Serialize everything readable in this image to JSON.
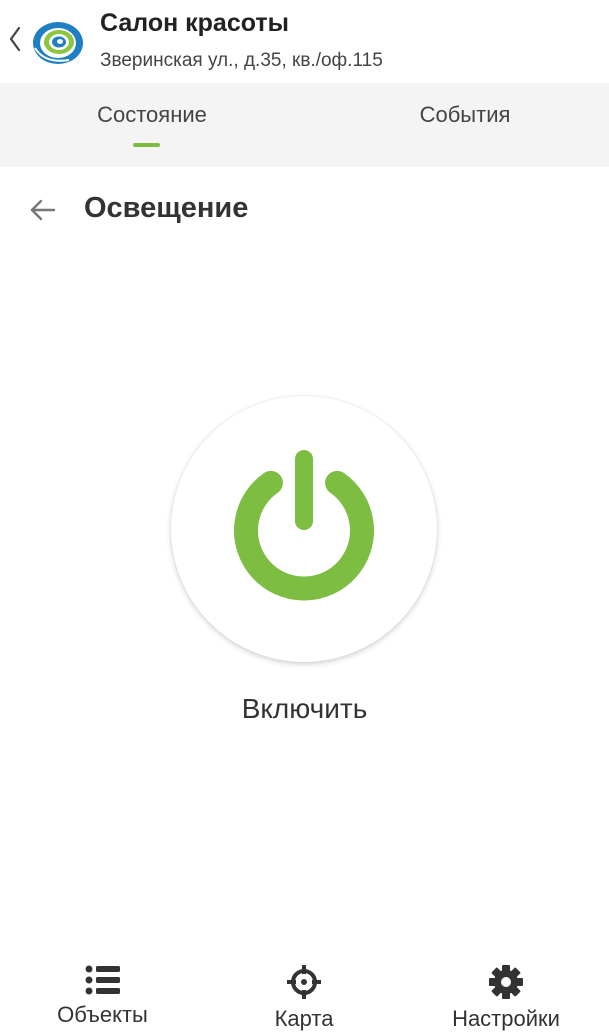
{
  "header": {
    "back_icon": "chevron-left-icon",
    "logo": "company-logo",
    "title": "Салон красоты",
    "subtitle": "Зверинская ул., д.35, кв./оф.115"
  },
  "tabs": [
    {
      "label": "Состояние",
      "active": true
    },
    {
      "label": "События",
      "active": false
    }
  ],
  "section": {
    "back_icon": "arrow-left-icon",
    "title": "Освещение"
  },
  "power": {
    "icon": "power-icon",
    "label": "Включить"
  },
  "bottom_nav": [
    {
      "label": "Объекты",
      "icon": "list-icon"
    },
    {
      "label": "Карта",
      "icon": "crosshair-icon"
    },
    {
      "label": "Настройки",
      "icon": "gear-icon"
    }
  ],
  "colors": {
    "accent": "#7cbd42",
    "logo_blue": "#1e7fc2",
    "logo_green": "#8cc63f",
    "tabs_bg": "#f4f4f4"
  }
}
